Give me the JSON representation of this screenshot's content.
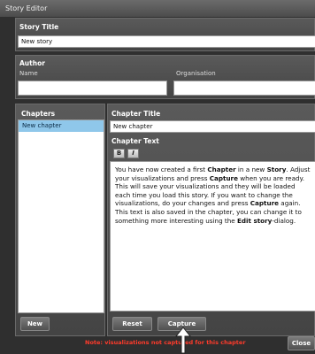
{
  "window": {
    "title": "Story Editor"
  },
  "story": {
    "title_label": "Story Title",
    "title_value": "New story"
  },
  "author": {
    "section_label": "Author",
    "name_label": "Name",
    "org_label": "Organisation",
    "name_value": "",
    "org_value": ""
  },
  "chapters": {
    "label": "Chapters",
    "items": [
      "New chapter"
    ],
    "new_button": "New"
  },
  "chapter": {
    "title_label": "Chapter Title",
    "title_value": "New chapter",
    "text_label": "Chapter Text",
    "bold_button": "B",
    "italic_button": "I",
    "text_parts": {
      "p1_a": "You have now created a first ",
      "p1_b": "Chapter",
      "p1_c": " in a new ",
      "p1_d": "Story",
      "p1_e": ". Adjust your visualizations and press ",
      "p1_f": "Capture",
      "p1_g": " when you are ready. This will save your visualizations and they will be loaded each time you load this story. If you want to change the visualizations, do your changes and press ",
      "p1_h": "Capture",
      "p1_i": " again.",
      "p2_a": "This text is also saved in the chapter, you can change it to something more interesting using the ",
      "p2_b": "Edit story",
      "p2_c": "-dialog."
    }
  },
  "buttons": {
    "reset": "Reset",
    "capture": "Capture",
    "close": "Close"
  },
  "note": "Note: visualizations not captured for this chapter",
  "icons": {
    "pointer": "arrow-pointer-icon"
  }
}
